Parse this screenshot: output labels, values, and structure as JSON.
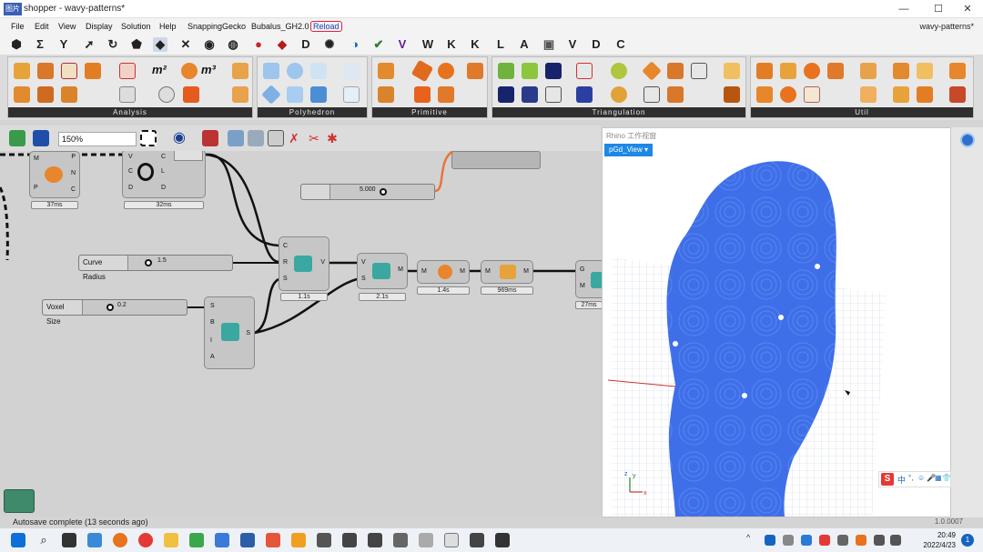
{
  "window": {
    "icon_label": "图片",
    "title": "shopper - wavy-patterns*",
    "minimize": "—",
    "maximize": "☐",
    "close": "✕"
  },
  "menu": {
    "items": [
      "File",
      "Edit",
      "View",
      "Display",
      "Solution",
      "Help",
      "SnappingGecko",
      "Bubalus_GH2.0",
      "Reload"
    ],
    "document_label": "wavy-patterns*"
  },
  "tabs": {
    "letters": [
      "W",
      "K",
      "K",
      "L",
      "A",
      "V",
      "D",
      "C"
    ],
    "glyphs": [
      "⬢",
      "Σ",
      "Y",
      "➚",
      "↻",
      "⬟",
      "◆",
      "✕",
      "◉",
      "◍",
      "●",
      "◆",
      "D",
      "✺",
      "◑",
      "✔",
      "V"
    ]
  },
  "ribbon": {
    "panels": [
      "Analysis",
      "Polyhedron",
      "Primitive",
      "Triangulation",
      "Util"
    ],
    "m2_a": "m²",
    "m3": "m³"
  },
  "canvas_toolbar": {
    "zoom": "150%"
  },
  "canvas": {
    "timers": [
      "37ms",
      "32ms",
      "1.1s",
      "2.1s",
      "1.4s",
      "969ms",
      "27ms"
    ],
    "sliders": {
      "unnamed_value": "5.000",
      "curve_radius_label": "Curve Radius",
      "curve_radius_value": "1.5",
      "voxel_size_label": "Voxel Size",
      "voxel_size_value": "0.2"
    },
    "ports": {
      "n1_in": [
        "M",
        "P"
      ],
      "n1_out": [
        "P",
        "N",
        "C"
      ],
      "n2_in": [
        "V",
        "C",
        "D"
      ],
      "n2_out": [
        "C",
        "L",
        "D"
      ],
      "n3_in": [
        "C",
        "R",
        "S"
      ],
      "n3_out": [
        "V"
      ],
      "n4_in": [
        "V",
        "S"
      ],
      "n4_out": [
        "M"
      ],
      "n5_in": [
        "M"
      ],
      "n5_out": [
        "M"
      ],
      "n6_in": [
        "M"
      ],
      "n6_out": [
        "M"
      ],
      "n7_in": [
        "G",
        "M"
      ],
      "n8_in": [
        "S",
        "B",
        "I",
        "A"
      ],
      "n8_out": [
        "S"
      ]
    }
  },
  "status": {
    "autosave": "Autosave complete (13 seconds ago)",
    "version": "1.0.0007"
  },
  "rhino": {
    "panel_title": "Rhino 工作视窗",
    "viewport_tab": "pGd_View",
    "viewport_tab_arrow": "▾",
    "axis_x": "x",
    "axis_y": "y",
    "axis_z": "z",
    "ime_glyphs": [
      "S",
      "中",
      "°,",
      "☺",
      "🎤",
      "▦",
      "👕",
      "⁞⁞"
    ]
  },
  "taskbar": {
    "time": "20:49",
    "date": "2022/4/23",
    "notification": "1"
  },
  "colors": {
    "model_blue": "#3f6fe8",
    "wire_black": "#111111",
    "wire_orange": "#e8743a",
    "viewport_tab": "#1e88e5"
  }
}
